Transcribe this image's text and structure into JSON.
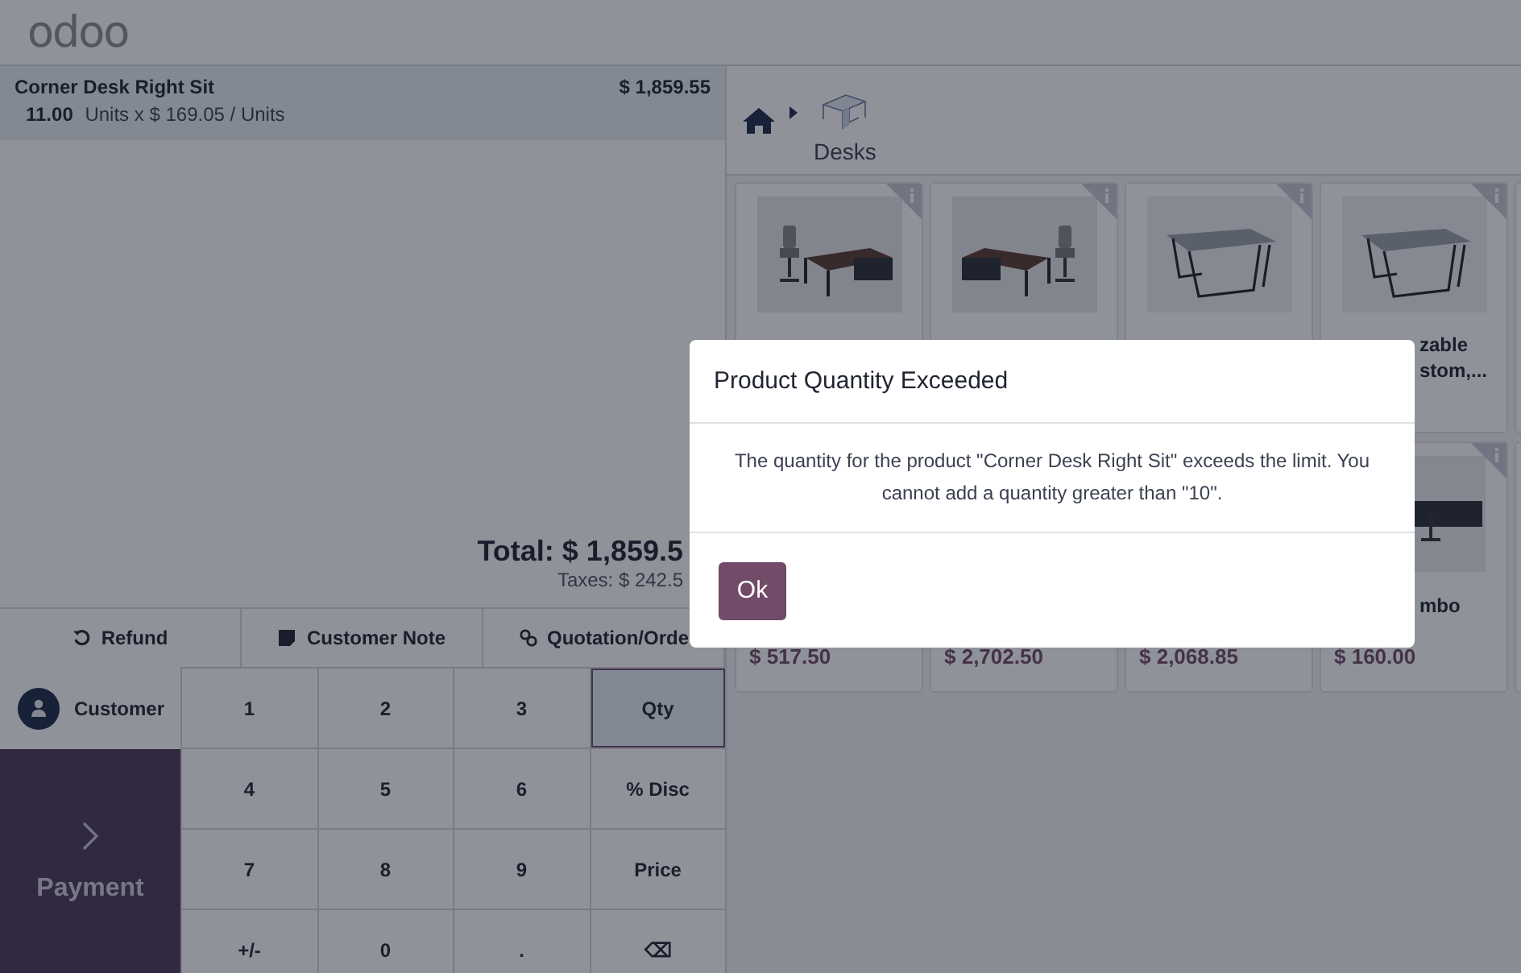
{
  "header": {
    "logo": "odoo"
  },
  "order_lines": [
    {
      "name": "Corner Desk Right Sit",
      "price": "$ 1,859.55",
      "quantity": "11.00",
      "unit_text": "Units x $ 169.05 / Units",
      "selected": true
    }
  ],
  "totals": {
    "total": "Total: $ 1,859.5",
    "taxes": "Taxes: $ 242.5"
  },
  "actions": [
    {
      "kind": "refund",
      "label": "Refund"
    },
    {
      "kind": "note",
      "label": "Customer Note"
    },
    {
      "kind": "link",
      "label": "Quotation/Orde"
    }
  ],
  "customer_button": {
    "label": "Customer"
  },
  "payment_button": {
    "label": "Payment"
  },
  "numpad": [
    {
      "kind": "digit",
      "label": "1"
    },
    {
      "kind": "digit",
      "label": "2"
    },
    {
      "kind": "digit",
      "label": "3"
    },
    {
      "kind": "mode",
      "label": "Qty",
      "selected": true
    },
    {
      "kind": "digit",
      "label": "4"
    },
    {
      "kind": "digit",
      "label": "5"
    },
    {
      "kind": "digit",
      "label": "6"
    },
    {
      "kind": "mode",
      "label": "% Disc",
      "selected": false
    },
    {
      "kind": "digit",
      "label": "7"
    },
    {
      "kind": "digit",
      "label": "8"
    },
    {
      "kind": "digit",
      "label": "9"
    },
    {
      "kind": "mode",
      "label": "Price",
      "selected": false
    },
    {
      "kind": "digit",
      "label": "+/-"
    },
    {
      "kind": "digit",
      "label": "0"
    },
    {
      "kind": "digit",
      "label": "."
    },
    {
      "kind": "digit",
      "label": "⌫"
    }
  ],
  "breadcrumb": {
    "category": "Desks"
  },
  "products": [
    {
      "kind": "desk"
    },
    {
      "kind": "desk"
    },
    {
      "kind": "table"
    },
    {
      "kind": "table",
      "name": [
        "zable",
        "stom,..."
      ]
    },
    {
      "kind": "plain",
      "price": "$ 517.50"
    },
    {
      "kind": "plain",
      "price": "$ 2,702.50"
    },
    {
      "kind": "plain",
      "price": "$ 2,068.85"
    },
    {
      "kind": "combo",
      "name": [
        "mbo"
      ],
      "price": "$ 160.00"
    }
  ],
  "dialog": {
    "title": "Product Quantity Exceeded",
    "message": "The quantity for the product \"Corner Desk Right Sit\" exceeds the limit. You cannot add a quantity greater than \"10\".",
    "button": "Ok"
  }
}
